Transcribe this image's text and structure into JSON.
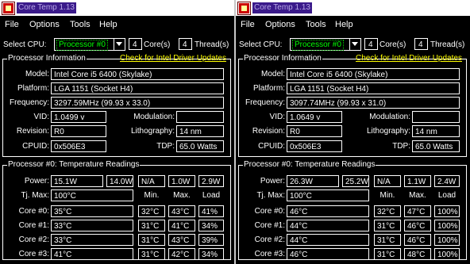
{
  "windows": [
    {
      "title": "Core Temp 1.13",
      "menu": [
        "File",
        "Options",
        "Tools",
        "Help"
      ],
      "select_cpu_label": "Select CPU:",
      "cpu_selected": "Processor #0",
      "cores": "4",
      "cores_label": "Core(s)",
      "threads": "4",
      "threads_label": "Thread(s)",
      "proc_info_title": "Processor Information",
      "driver_link": "Check for Intel Driver Updates",
      "model_label": "Model:",
      "model": "Intel Core i5 6400 (Skylake)",
      "platform_label": "Platform:",
      "platform": "LGA 1151 (Socket H4)",
      "frequency_label": "Frequency:",
      "frequency": "3297.59MHz (99.93 x 33.0)",
      "vid_label": "VID:",
      "vid": "1.0499 v",
      "modulation_label": "Modulation:",
      "modulation": "",
      "revision_label": "Revision:",
      "revision": "R0",
      "lithography_label": "Lithography:",
      "lithography": "14 nm",
      "cpuid_label": "CPUID:",
      "cpuid": "0x506E3",
      "tdp_label": "TDP:",
      "tdp": "65.0 Watts",
      "temp_title": "Processor #0: Temperature Readings",
      "power_label": "Power:",
      "power": [
        "15.1W",
        "14.0W",
        "N/A",
        "1.0W",
        "2.9W"
      ],
      "tjmax_label": "Tj. Max:",
      "tjmax": "100°C",
      "col_min": "Min.",
      "col_max": "Max.",
      "col_load": "Load",
      "cores_rows": [
        {
          "label": "Core #0:",
          "temp": "35°C",
          "min": "32°C",
          "max": "43°C",
          "load": "41%"
        },
        {
          "label": "Core #1:",
          "temp": "33°C",
          "min": "31°C",
          "max": "41°C",
          "load": "34%"
        },
        {
          "label": "Core #2:",
          "temp": "33°C",
          "min": "31°C",
          "max": "43°C",
          "load": "39%"
        },
        {
          "label": "Core #3:",
          "temp": "41°C",
          "min": "31°C",
          "max": "42°C",
          "load": "34%"
        }
      ]
    },
    {
      "title": "Core Temp 1.13",
      "menu": [
        "File",
        "Options",
        "Tools",
        "Help"
      ],
      "select_cpu_label": "Select CPU:",
      "cpu_selected": "Processor #0",
      "cores": "4",
      "cores_label": "Core(s)",
      "threads": "4",
      "threads_label": "Thread(s)",
      "proc_info_title": "Processor Information",
      "driver_link": "Check for Intel Driver Updates",
      "model_label": "Model:",
      "model": "Intel Core i5 6400 (Skylake)",
      "platform_label": "Platform:",
      "platform": "LGA 1151 (Socket H4)",
      "frequency_label": "Frequency:",
      "frequency": "3097.74MHz (99.93 x 31.0)",
      "vid_label": "VID:",
      "vid": "1.0649 v",
      "modulation_label": "Modulation:",
      "modulation": "",
      "revision_label": "Revision:",
      "revision": "R0",
      "lithography_label": "Lithography:",
      "lithography": "14 nm",
      "cpuid_label": "CPUID:",
      "cpuid": "0x506E3",
      "tdp_label": "TDP:",
      "tdp": "65.0 Watts",
      "temp_title": "Processor #0: Temperature Readings",
      "power_label": "Power:",
      "power": [
        "26.3W",
        "25.2W",
        "N/A",
        "1.1W",
        "2.4W"
      ],
      "tjmax_label": "Tj. Max:",
      "tjmax": "100°C",
      "col_min": "Min.",
      "col_max": "Max.",
      "col_load": "Load",
      "cores_rows": [
        {
          "label": "Core #0:",
          "temp": "46°C",
          "min": "32°C",
          "max": "47°C",
          "load": "100%"
        },
        {
          "label": "Core #1:",
          "temp": "44°C",
          "min": "31°C",
          "max": "46°C",
          "load": "100%"
        },
        {
          "label": "Core #2:",
          "temp": "44°C",
          "min": "31°C",
          "max": "46°C",
          "load": "100%"
        },
        {
          "label": "Core #3:",
          "temp": "46°C",
          "min": "31°C",
          "max": "48°C",
          "load": "100%"
        }
      ]
    }
  ]
}
